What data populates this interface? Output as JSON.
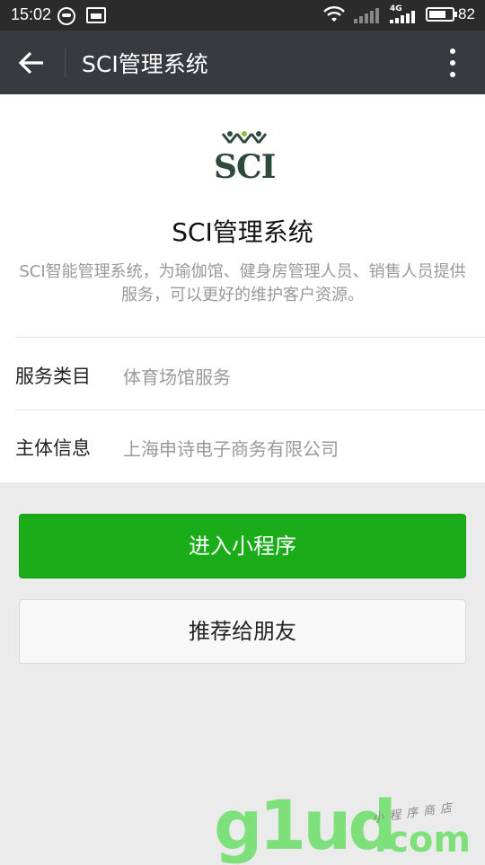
{
  "status_bar": {
    "time": "15:02",
    "network": "4G",
    "battery": "82"
  },
  "nav": {
    "title": "SCI管理系统",
    "back_icon": "arrow-left-icon",
    "more_icon": "more-vertical-icon"
  },
  "app": {
    "logo_text": "SCI",
    "name": "SCI管理系统",
    "description": "SCI智能管理系统，为瑜伽馆、健身房管理人员、销售人员提供服务，可以更好的维护客户资源。"
  },
  "info_rows": [
    {
      "label": "服务类目",
      "value": "体育场馆服务"
    },
    {
      "label": "主体信息",
      "value": "上海申诗电子商务有限公司"
    }
  ],
  "buttons": {
    "enter": "进入小程序",
    "recommend": "推荐给朋友"
  },
  "watermark": {
    "brand": "g1ud",
    "domain": ".com",
    "tagline": "小程序商店"
  },
  "colors": {
    "primary": "#1aad19",
    "navbar": "#393a3f",
    "statusbar": "#2b2b2b",
    "background": "#ebebeb"
  }
}
